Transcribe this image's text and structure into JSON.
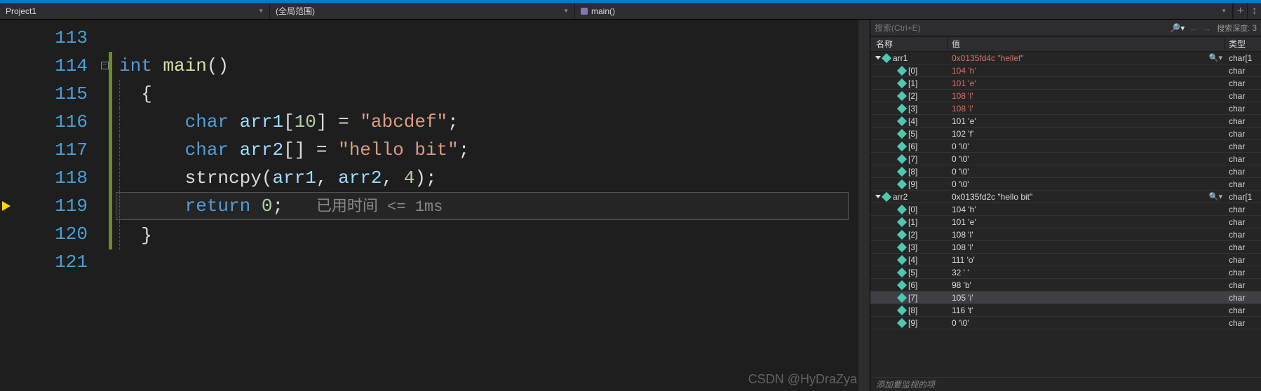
{
  "nav": {
    "project": "Project1",
    "scope": "(全局范围)",
    "function": "main()"
  },
  "search": {
    "placeholder": "搜索(Ctrl+E)",
    "depth_label": "搜索深度:",
    "depth_value": "3"
  },
  "editor": {
    "lines_start": 113,
    "current_line": 119,
    "time_hint": "已用时间 <= 1ms"
  },
  "code": {
    "l114_int": "int",
    "l114_main": "main",
    "l114_paren": "()",
    "l115_brace": "{",
    "l116_char": "char",
    "l116_arr1": "arr1",
    "l116_br": "[",
    "l116_10": "10",
    "l116_br2": "] = ",
    "l116_str": "\"abcdef\"",
    "l116_semi": ";",
    "l117_char": "char",
    "l117_arr2": "arr2",
    "l117_br": "[] = ",
    "l117_str": "\"hello bit\"",
    "l117_semi": ";",
    "l118_fn": "strncpy",
    "l118_p1": "(",
    "l118_a1": "arr1",
    "l118_c1": ", ",
    "l118_a2": "arr2",
    "l118_c2": ", ",
    "l118_n": "4",
    "l118_p2": ");",
    "l119_ret": "return",
    "l119_sp": " ",
    "l119_0": "0",
    "l119_semi": ";",
    "l120_brace": "}"
  },
  "watch": {
    "headers": {
      "name": "名称",
      "value": "值",
      "type": "类型"
    },
    "footer": "添加要监视的项",
    "rows": [
      {
        "depth": 0,
        "expanded": true,
        "name": "arr1",
        "value": "0x0135fd4c \"hellef\"",
        "type": "char[1",
        "changed": true,
        "mag": true,
        "selected": false
      },
      {
        "depth": 1,
        "name": "[0]",
        "value": "104 'h'",
        "type": "char",
        "changed": true,
        "selected": false
      },
      {
        "depth": 1,
        "name": "[1]",
        "value": "101 'e'",
        "type": "char",
        "changed": true,
        "selected": false
      },
      {
        "depth": 1,
        "name": "[2]",
        "value": "108 'l'",
        "type": "char",
        "changed": true,
        "selected": false
      },
      {
        "depth": 1,
        "name": "[3]",
        "value": "108 'l'",
        "type": "char",
        "changed": true,
        "selected": false
      },
      {
        "depth": 1,
        "name": "[4]",
        "value": "101 'e'",
        "type": "char",
        "changed": false,
        "selected": false
      },
      {
        "depth": 1,
        "name": "[5]",
        "value": "102 'f'",
        "type": "char",
        "changed": false,
        "selected": false
      },
      {
        "depth": 1,
        "name": "[6]",
        "value": "0 '\\0'",
        "type": "char",
        "changed": false,
        "selected": false
      },
      {
        "depth": 1,
        "name": "[7]",
        "value": "0 '\\0'",
        "type": "char",
        "changed": false,
        "selected": false
      },
      {
        "depth": 1,
        "name": "[8]",
        "value": "0 '\\0'",
        "type": "char",
        "changed": false,
        "selected": false
      },
      {
        "depth": 1,
        "name": "[9]",
        "value": "0 '\\0'",
        "type": "char",
        "changed": false,
        "selected": false
      },
      {
        "depth": 0,
        "expanded": true,
        "name": "arr2",
        "value": "0x0135fd2c \"hello bit\"",
        "type": "char[1",
        "changed": false,
        "mag": true,
        "selected": false
      },
      {
        "depth": 1,
        "name": "[0]",
        "value": "104 'h'",
        "type": "char",
        "changed": false,
        "selected": false
      },
      {
        "depth": 1,
        "name": "[1]",
        "value": "101 'e'",
        "type": "char",
        "changed": false,
        "selected": false
      },
      {
        "depth": 1,
        "name": "[2]",
        "value": "108 'l'",
        "type": "char",
        "changed": false,
        "selected": false
      },
      {
        "depth": 1,
        "name": "[3]",
        "value": "108 'l'",
        "type": "char",
        "changed": false,
        "selected": false
      },
      {
        "depth": 1,
        "name": "[4]",
        "value": "111 'o'",
        "type": "char",
        "changed": false,
        "selected": false
      },
      {
        "depth": 1,
        "name": "[5]",
        "value": "32 ' '",
        "type": "char",
        "changed": false,
        "selected": false
      },
      {
        "depth": 1,
        "name": "[6]",
        "value": "98 'b'",
        "type": "char",
        "changed": false,
        "selected": false
      },
      {
        "depth": 1,
        "name": "[7]",
        "value": "105 'i'",
        "type": "char",
        "changed": false,
        "selected": true
      },
      {
        "depth": 1,
        "name": "[8]",
        "value": "116 't'",
        "type": "char",
        "changed": false,
        "selected": false
      },
      {
        "depth": 1,
        "name": "[9]",
        "value": "0 '\\0'",
        "type": "char",
        "changed": false,
        "selected": false
      }
    ]
  },
  "watermark": "CSDN @HyDraZya"
}
